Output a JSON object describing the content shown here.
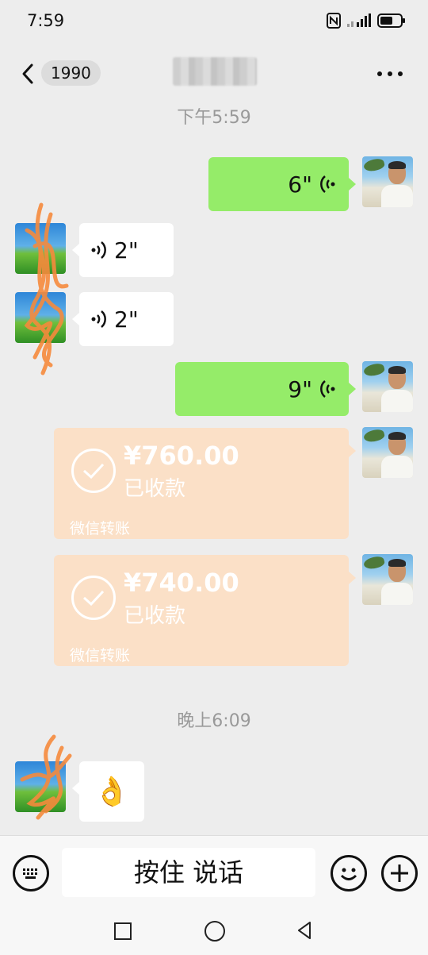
{
  "status_bar": {
    "time": "7:59"
  },
  "header": {
    "unread_count": "1990"
  },
  "messages": {
    "time1": "下午5:59",
    "voice_out_1": "6\"",
    "voice_in_1": "2\"",
    "voice_in_2": "2\"",
    "voice_out_2": "9\"",
    "transfer1": {
      "amount": "¥760.00",
      "status": "已收款",
      "label": "微信转账"
    },
    "transfer2": {
      "amount": "¥740.00",
      "status": "已收款",
      "label": "微信转账"
    },
    "time2": "晚上6:09",
    "emoji": "👌"
  },
  "input_bar": {
    "hold_to_talk": "按住 说话"
  },
  "colors": {
    "sent_bubble": "#95ec69",
    "transfer_card": "#fbe0c7",
    "background": "#ededed"
  }
}
